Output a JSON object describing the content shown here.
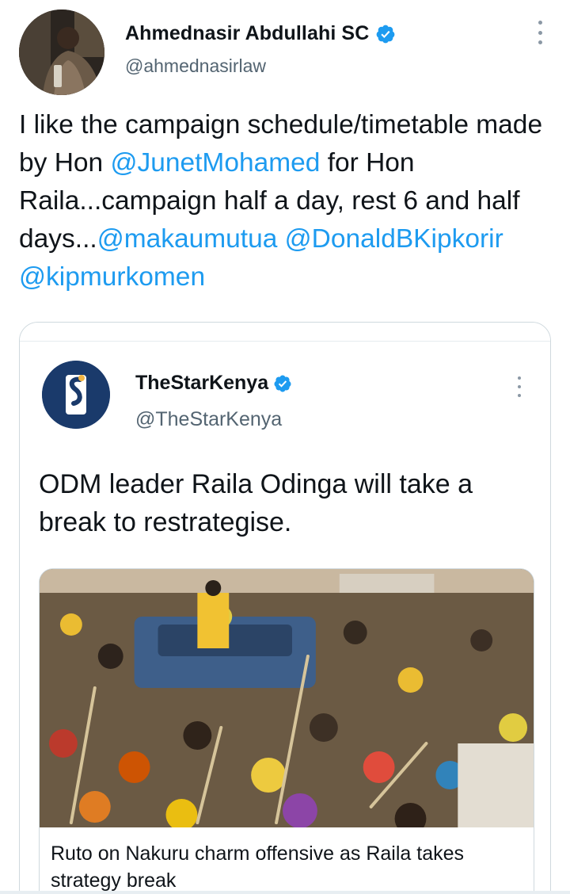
{
  "author": {
    "display_name": "Ahmednasir Abdullahi SC",
    "handle": "@ahmednasirlaw",
    "verified": true,
    "avatar_icon": "profile-photo"
  },
  "tweet": {
    "parts": [
      {
        "text": "I like the campaign schedule/timetable made by Hon ",
        "type": "text"
      },
      {
        "text": "@JunetMohamed",
        "type": "mention"
      },
      {
        "text": " for Hon Raila...campaign half a day, rest 6 and half days...",
        "type": "text"
      },
      {
        "text": "@makaumutua",
        "type": "mention"
      },
      {
        "text": " ",
        "type": "text"
      },
      {
        "text": "@DonaldBKipkorir",
        "type": "mention"
      },
      {
        "text": " ",
        "type": "text"
      },
      {
        "text": "@kipmurkomen",
        "type": "mention"
      }
    ]
  },
  "quoted": {
    "display_name": "TheStarKenya",
    "handle": "@TheStarKenya",
    "verified": true,
    "avatar_icon": "the-star-logo",
    "text": "ODM leader Raila Odinga will take a break to restrategise.",
    "link_card": {
      "image_icon": "rally-crowd-photo",
      "title": "Ruto on Nakuru charm offensive as Raila takes strategy break"
    }
  },
  "colors": {
    "mention": "#1d9bf0",
    "verified": "#1d9bf0",
    "text": "#0f1419",
    "secondary": "#536471",
    "border": "#cfd9de"
  }
}
